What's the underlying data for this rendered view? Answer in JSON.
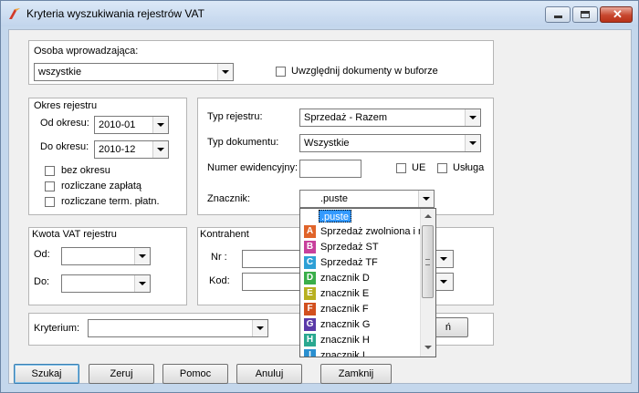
{
  "window": {
    "title": "Kryteria wyszukiwania rejestrów VAT"
  },
  "osoba": {
    "label": "Osoba wprowadzająca:",
    "value": "wszystkie",
    "bufor_label": "Uwzględnij dokumenty w buforze"
  },
  "okres": {
    "title": "Okres rejestru",
    "od_label": "Od okresu:",
    "od_value": "2010-01",
    "do_label": "Do okresu:",
    "do_value": "2010-12",
    "checks": [
      "bez okresu",
      "rozliczane zapłatą",
      "rozliczane term. płatn."
    ]
  },
  "typ": {
    "typ_rejestru_label": "Typ rejestru:",
    "typ_rejestru_value": "Sprzedaż - Razem",
    "typ_dokumentu_label": "Typ dokumentu:",
    "typ_dokumentu_value": "Wszystkie",
    "numer_label": "Numer ewidencyjny:",
    "ue_label": "UE",
    "usluga_label": "Usługa",
    "znacznik_label": "Znacznik:",
    "znacznik_value": ".puste"
  },
  "kwota": {
    "title": "Kwota VAT rejestru",
    "od_label": "Od:",
    "do_label": "Do:"
  },
  "kontrahent": {
    "title": "Kontrahent",
    "nr_label": "Nr :",
    "kod_label": "Kod:"
  },
  "kryterium": {
    "label": "Kryterium:",
    "button_label": "ń"
  },
  "dropdown": {
    "selected": ".puste",
    "items": [
      {
        "badge": "A",
        "text": "Sprzedaż zwolniona i n",
        "color": "#e0642a"
      },
      {
        "badge": "B",
        "text": "Sprzedaż ST",
        "color": "#c8409c"
      },
      {
        "badge": "C",
        "text": "Sprzedaż TF",
        "color": "#2ea0d6"
      },
      {
        "badge": "D",
        "text": "znacznik D",
        "color": "#3aae4a"
      },
      {
        "badge": "E",
        "text": "znacznik E",
        "color": "#b8b020"
      },
      {
        "badge": "F",
        "text": "znacznik F",
        "color": "#d2501e"
      },
      {
        "badge": "G",
        "text": "znacznik G",
        "color": "#5a3aa8"
      },
      {
        "badge": "H",
        "text": "znacznik H",
        "color": "#2aa890"
      },
      {
        "badge": "I",
        "text": "znacznik I",
        "color": "#2a8fd0"
      }
    ]
  },
  "buttons": {
    "szukaj": "Szukaj",
    "zeruj": "Zeruj",
    "pomoc": "Pomoc",
    "anuluj": "Anuluj",
    "zamknij": "Zamknij"
  }
}
